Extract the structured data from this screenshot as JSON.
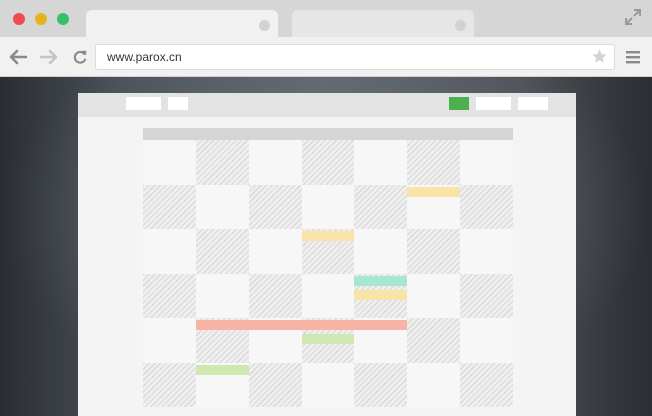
{
  "browser": {
    "url": "www.parox.cn",
    "colors": {
      "close": "#ef4b4b",
      "minimize": "#e3b41f",
      "maximize": "#35c06a"
    }
  },
  "app": {
    "header_accent": "#4caf50",
    "calendar": {
      "rows": 6,
      "cols": 7,
      "events": [
        {
          "row": 1,
          "col_start": 5,
          "col_end": 5,
          "color": "#f9e4a8"
        },
        {
          "row": 2,
          "col_start": 3,
          "col_end": 3,
          "color": "#f9e4a8"
        },
        {
          "row": 3,
          "col_start": 4,
          "col_end": 4,
          "color": "#a8e6d4"
        },
        {
          "row": 3,
          "col_start": 4,
          "col_end": 4,
          "color": "#f9e4a8",
          "slot": 2
        },
        {
          "row": 4,
          "col_start": 1,
          "col_end": 4,
          "color": "#f8b3a7"
        },
        {
          "row": 4,
          "col_start": 3,
          "col_end": 3,
          "color": "#cfe8b0",
          "slot": 2
        },
        {
          "row": 5,
          "col_start": 1,
          "col_end": 1,
          "color": "#cfe8b0"
        }
      ]
    }
  }
}
